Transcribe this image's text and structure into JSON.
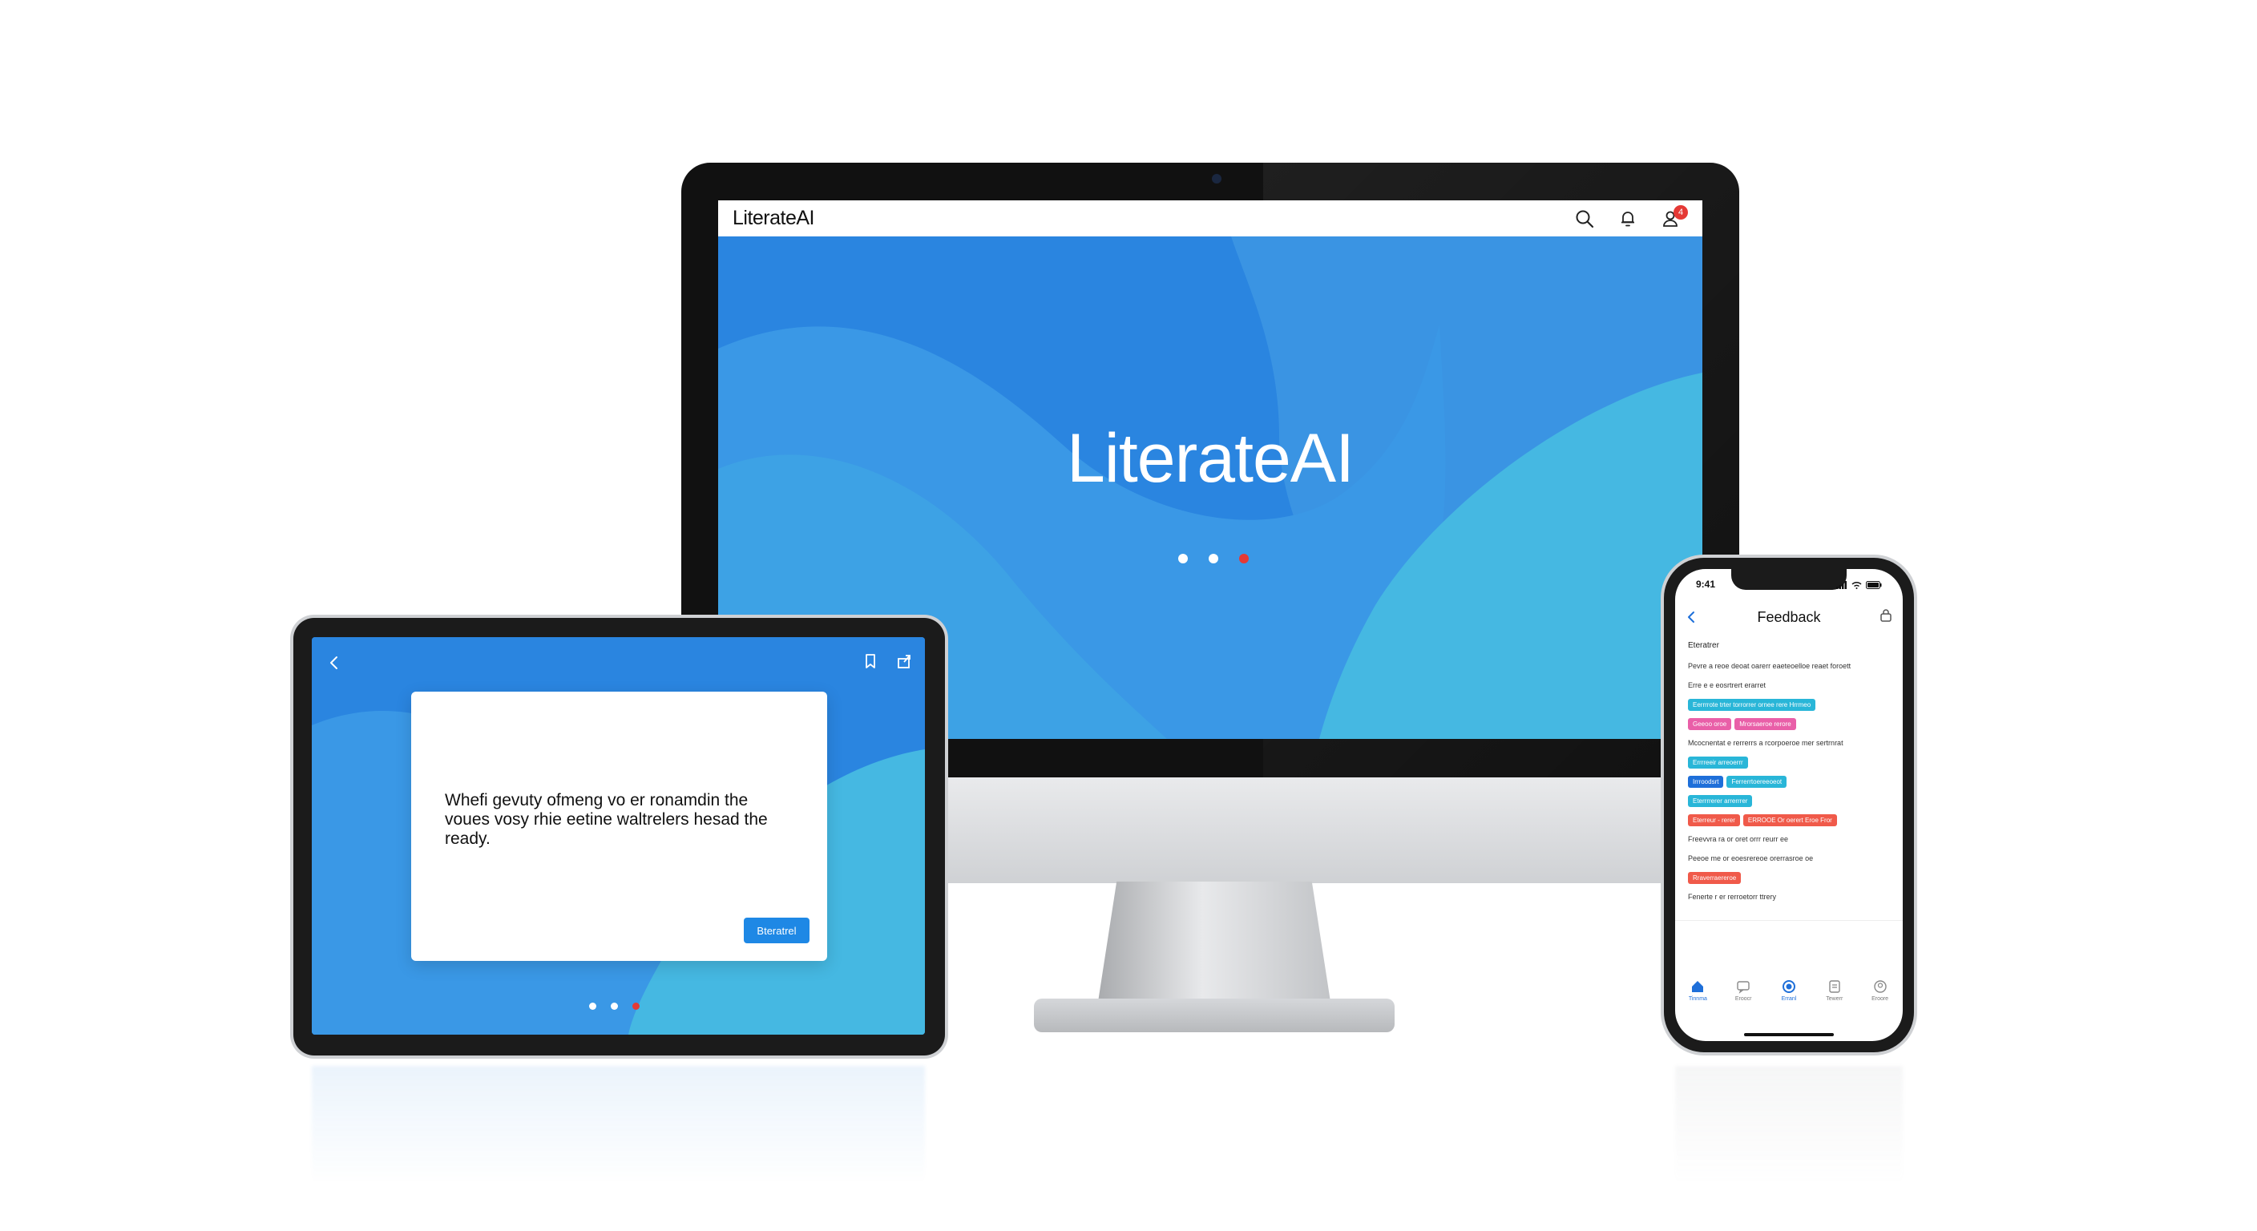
{
  "colors": {
    "accent_blue": "#2a85e0",
    "light_blue": "#45b8e2",
    "alert_red": "#e53935",
    "button_blue": "#1e88e5"
  },
  "desktop": {
    "brand": "LiterateAI",
    "hero_title": "LiterateAI",
    "icons": [
      "search-icon",
      "bell-icon",
      "profile-icon"
    ],
    "notification_count": "4",
    "carousel": {
      "total": 3,
      "active_index": 2
    }
  },
  "tablet": {
    "dialog_text": "Whefi gevuty ofmeng vo er ronamdin the voues vosy  rhie eetine waltrelers hesad the ready.",
    "dialog_button": "Bteratrel",
    "icons": [
      "back-icon",
      "bookmark-icon",
      "share-icon"
    ],
    "carousel": {
      "total": 3,
      "active_index": 2
    }
  },
  "phone": {
    "time": "9:41",
    "title": "Feedback",
    "section": "Eteratrer",
    "lines": [
      "Pevre a reoe deoat oarerr eaeteoelloe reaet foroett",
      "Erre e e eosrtrert erarret",
      "Mcocnentat e rerrerrs a rcorpoeroe mer sertrnrat",
      "Freevvra ra or oret orrr reurr ee",
      "Peeoe me or eoesrereoe orerrasroe oe"
    ],
    "chips": [
      {
        "label": "Eerrrrote trter torrorrer ornee rere Hrrmeo",
        "color": "#29b6d8"
      },
      {
        "label": "Geeoo oroe",
        "color": "#e95fa8"
      },
      {
        "label": "Mrorsaeroe rerore",
        "color": "#e95fa8"
      },
      {
        "label": "Errrreeir arreoerrr",
        "color": "#29b6d8"
      },
      {
        "label": "Irrroodsrt",
        "color": "#1e6fd9"
      },
      {
        "label": "Ferrerrtoereeoeot",
        "color": "#29b6d8"
      },
      {
        "label": "Eterrrrerer arrerrrer",
        "color": "#29b6d8"
      },
      {
        "label": "Eterreur - rerer",
        "color": "#f05a4a"
      },
      {
        "label": "ERROOE Or oerert Eroe Fror",
        "color": "#f05a4a"
      },
      {
        "label": "Rraverraereroe",
        "color": "#f05a4a"
      }
    ],
    "footer_line": "Fenerte r er rerroetorr ttrery",
    "tabs": [
      {
        "label": "Tinnma",
        "icon": "home-icon",
        "active": true
      },
      {
        "label": "Eroocr",
        "icon": "chat-icon",
        "active": false
      },
      {
        "label": "Erranl",
        "icon": "record-icon",
        "active": true
      },
      {
        "label": "Tewerr",
        "icon": "document-icon",
        "active": false
      },
      {
        "label": "Eroore",
        "icon": "profile-icon",
        "active": false
      }
    ]
  }
}
